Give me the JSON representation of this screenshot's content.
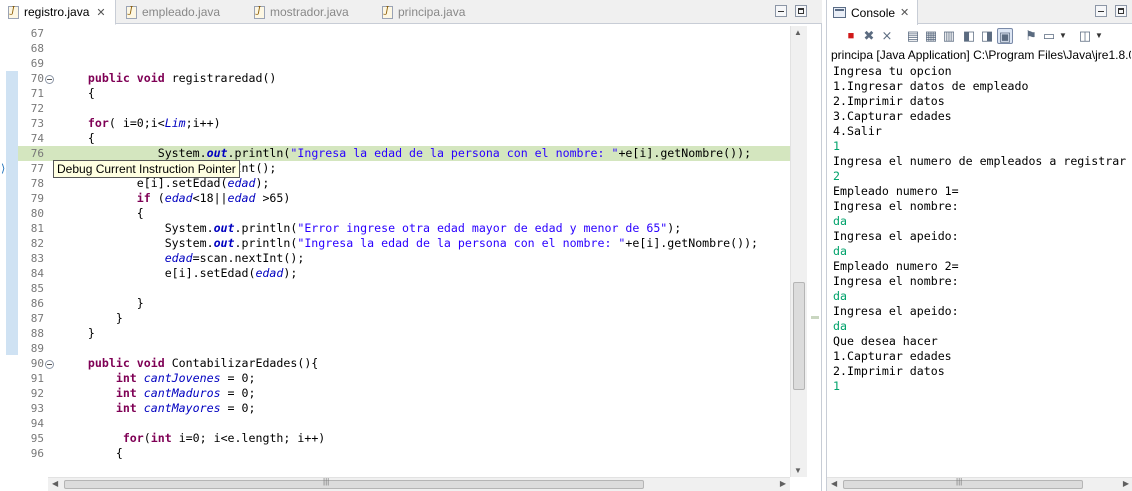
{
  "editor": {
    "tabs": [
      {
        "label": "registro.java",
        "active": true
      },
      {
        "label": "empleado.java",
        "active": false
      },
      {
        "label": "mostrador.java",
        "active": false
      },
      {
        "label": "principa.java",
        "active": false
      }
    ],
    "tooltip": "Debug Current Instruction Pointer",
    "lines": [
      {
        "num": "67",
        "segs": []
      },
      {
        "num": "68",
        "segs": []
      },
      {
        "num": "69",
        "segs": []
      },
      {
        "num": "70",
        "fold": true,
        "segs": [
          [
            "p",
            "    "
          ],
          [
            "kw",
            "public"
          ],
          [
            "p",
            " "
          ],
          [
            "kw",
            "void"
          ],
          [
            "p",
            " registraredad()"
          ]
        ]
      },
      {
        "num": "71",
        "segs": [
          [
            "p",
            "    {"
          ]
        ]
      },
      {
        "num": "72",
        "segs": []
      },
      {
        "num": "73",
        "segs": [
          [
            "p",
            "    "
          ],
          [
            "kw",
            "for"
          ],
          [
            "p",
            "( i=0;i<"
          ],
          [
            "fld",
            "Lim"
          ],
          [
            "p",
            ";i++)"
          ]
        ]
      },
      {
        "num": "74",
        "segs": [
          [
            "p",
            "    {"
          ]
        ]
      },
      {
        "num": "76",
        "hl": true,
        "segs": [
          [
            "p",
            "              System."
          ],
          [
            "sfld",
            "out"
          ],
          [
            "p",
            ".println("
          ],
          [
            "str",
            "\"Ingresa la edad de la persona con el nombre: \""
          ],
          [
            "p",
            "+e[i].getNombre());"
          ]
        ]
      },
      {
        "num": "77",
        "segs": [
          [
            "p",
            "           "
          ],
          [
            "var",
            "edad"
          ],
          [
            "p",
            "=scan.nextInt();"
          ]
        ]
      },
      {
        "num": "78",
        "segs": [
          [
            "p",
            "           e[i].setEdad("
          ],
          [
            "var",
            "edad"
          ],
          [
            "p",
            ");"
          ]
        ]
      },
      {
        "num": "79",
        "segs": [
          [
            "p",
            "           "
          ],
          [
            "kw",
            "if"
          ],
          [
            "p",
            " ("
          ],
          [
            "var",
            "edad"
          ],
          [
            "p",
            "<18||"
          ],
          [
            "var",
            "edad"
          ],
          [
            "p",
            " >65)"
          ]
        ]
      },
      {
        "num": "80",
        "segs": [
          [
            "p",
            "           {"
          ]
        ]
      },
      {
        "num": "81",
        "segs": [
          [
            "p",
            "               System."
          ],
          [
            "sfld",
            "out"
          ],
          [
            "p",
            ".println("
          ],
          [
            "str",
            "\"Error ingrese otra edad mayor de edad y menor de 65\""
          ],
          [
            "p",
            ");"
          ]
        ]
      },
      {
        "num": "82",
        "segs": [
          [
            "p",
            "               System."
          ],
          [
            "sfld",
            "out"
          ],
          [
            "p",
            ".println("
          ],
          [
            "str",
            "\"Ingresa la edad de la persona con el nombre: \""
          ],
          [
            "p",
            "+e[i].getNombre());"
          ]
        ]
      },
      {
        "num": "83",
        "segs": [
          [
            "p",
            "               "
          ],
          [
            "var",
            "edad"
          ],
          [
            "p",
            "=scan.nextInt();"
          ]
        ]
      },
      {
        "num": "84",
        "segs": [
          [
            "p",
            "               e[i].setEdad("
          ],
          [
            "var",
            "edad"
          ],
          [
            "p",
            ");"
          ]
        ]
      },
      {
        "num": "85",
        "segs": []
      },
      {
        "num": "86",
        "segs": [
          [
            "p",
            "           }"
          ]
        ]
      },
      {
        "num": "87",
        "segs": [
          [
            "p",
            "        }"
          ]
        ]
      },
      {
        "num": "88",
        "segs": [
          [
            "p",
            "    }"
          ]
        ]
      },
      {
        "num": "89",
        "segs": []
      },
      {
        "num": "90",
        "fold": true,
        "segs": [
          [
            "p",
            "    "
          ],
          [
            "kw",
            "public"
          ],
          [
            "p",
            " "
          ],
          [
            "kw",
            "void"
          ],
          [
            "p",
            " ContabilizarEdades(){"
          ]
        ]
      },
      {
        "num": "91",
        "segs": [
          [
            "p",
            "        "
          ],
          [
            "kw",
            "int"
          ],
          [
            "p",
            " "
          ],
          [
            "var",
            "cantJovenes"
          ],
          [
            "p",
            " = 0;"
          ]
        ]
      },
      {
        "num": "92",
        "segs": [
          [
            "p",
            "        "
          ],
          [
            "kw",
            "int"
          ],
          [
            "p",
            " "
          ],
          [
            "var",
            "cantMaduros"
          ],
          [
            "p",
            " = 0;"
          ]
        ]
      },
      {
        "num": "93",
        "segs": [
          [
            "p",
            "        "
          ],
          [
            "kw",
            "int"
          ],
          [
            "p",
            " "
          ],
          [
            "var",
            "cantMayores"
          ],
          [
            "p",
            " = 0;"
          ]
        ]
      },
      {
        "num": "94",
        "segs": []
      },
      {
        "num": "95",
        "segs": [
          [
            "p",
            "         "
          ],
          [
            "kw",
            "for"
          ],
          [
            "p",
            "("
          ],
          [
            "kw",
            "int"
          ],
          [
            "p",
            " i=0; i<e.length; i++)"
          ]
        ]
      },
      {
        "num": "96",
        "segs": [
          [
            "p",
            "        {"
          ]
        ]
      }
    ]
  },
  "console": {
    "tab_label": "Console",
    "process": "principa [Java Application] C:\\Program Files\\Java\\jre1.8.0_",
    "lines": [
      {
        "text": "Ingresa tu opcion",
        "input": false
      },
      {
        "text": "1.Ingresar datos de empleado",
        "input": false
      },
      {
        "text": "2.Imprimir datos",
        "input": false
      },
      {
        "text": "3.Capturar edades",
        "input": false
      },
      {
        "text": "4.Salir",
        "input": false
      },
      {
        "text": "1",
        "input": true
      },
      {
        "text": "Ingresa el numero de empleados a registrar",
        "input": false
      },
      {
        "text": "2",
        "input": true
      },
      {
        "text": "Empleado numero 1=",
        "input": false
      },
      {
        "text": "Ingresa el nombre:",
        "input": false
      },
      {
        "text": "da",
        "input": true
      },
      {
        "text": "Ingresa el apeido:",
        "input": false
      },
      {
        "text": "da",
        "input": true
      },
      {
        "text": "Empleado numero 2=",
        "input": false
      },
      {
        "text": "Ingresa el nombre:",
        "input": false
      },
      {
        "text": "da",
        "input": true
      },
      {
        "text": "Ingresa el apeido:",
        "input": false
      },
      {
        "text": "da",
        "input": true
      },
      {
        "text": "Que desea hacer",
        "input": false
      },
      {
        "text": "1.Capturar edades",
        "input": false
      },
      {
        "text": "2.Imprimir datos",
        "input": false
      },
      {
        "text": "1",
        "input": true
      }
    ]
  },
  "colors": {
    "keyword": "#7f0055",
    "string": "#2a00ff",
    "field": "#0000c0",
    "console_input": "#00a26b",
    "current_line": "#d4e6bf",
    "tooltip_bg": "#ffffe1"
  }
}
